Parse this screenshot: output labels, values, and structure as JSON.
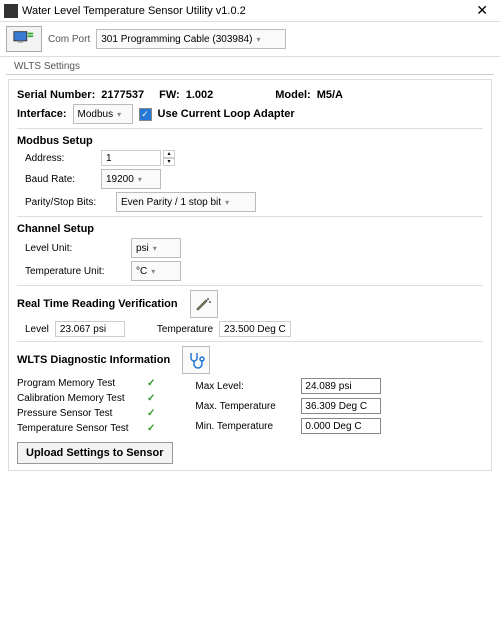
{
  "window": {
    "title": "Water Level Temperature Sensor Utility v1.0.2"
  },
  "toolbar": {
    "com_port_label": "Com Port",
    "com_port_value": "301 Programming Cable (303984)"
  },
  "settings_section_label": "WLTS Settings",
  "device": {
    "serial_label": "Serial Number:",
    "serial_value": "2177537",
    "fw_label": "FW:",
    "fw_value": "1.002",
    "model_label": "Model:",
    "model_value": "M5/A"
  },
  "interface": {
    "label": "Interface:",
    "value": "Modbus",
    "loop_adapter_label": "Use Current Loop Adapter",
    "loop_adapter_checked": true
  },
  "modbus": {
    "heading": "Modbus Setup",
    "address_label": "Address:",
    "address_value": "1",
    "baud_label": "Baud Rate:",
    "baud_value": "19200",
    "parity_label": "Parity/Stop Bits:",
    "parity_value": "Even Parity / 1 stop bit"
  },
  "channel": {
    "heading": "Channel Setup",
    "level_unit_label": "Level Unit:",
    "level_unit_value": "psi",
    "temp_unit_label": "Temperature Unit:",
    "temp_unit_value": "°C"
  },
  "realtime": {
    "heading": "Real Time Reading Verification",
    "level_label": "Level",
    "level_value": "23.067 psi",
    "temp_label": "Temperature",
    "temp_value": "23.500 Deg C"
  },
  "diag": {
    "heading": "WLTS Diagnostic Information",
    "tests": [
      {
        "name": "Program Memory Test",
        "pass": true
      },
      {
        "name": "Calibration Memory Test",
        "pass": true
      },
      {
        "name": "Pressure Sensor Test",
        "pass": true
      },
      {
        "name": "Temperature Sensor Test",
        "pass": true
      }
    ],
    "max_level_label": "Max Level:",
    "max_level_value": "24.089 psi",
    "max_temp_label": "Max. Temperature",
    "max_temp_value": "36.309 Deg C",
    "min_temp_label": "Min. Temperature",
    "min_temp_value": "0.000 Deg C"
  },
  "upload_button_label": "Upload Settings to Sensor"
}
